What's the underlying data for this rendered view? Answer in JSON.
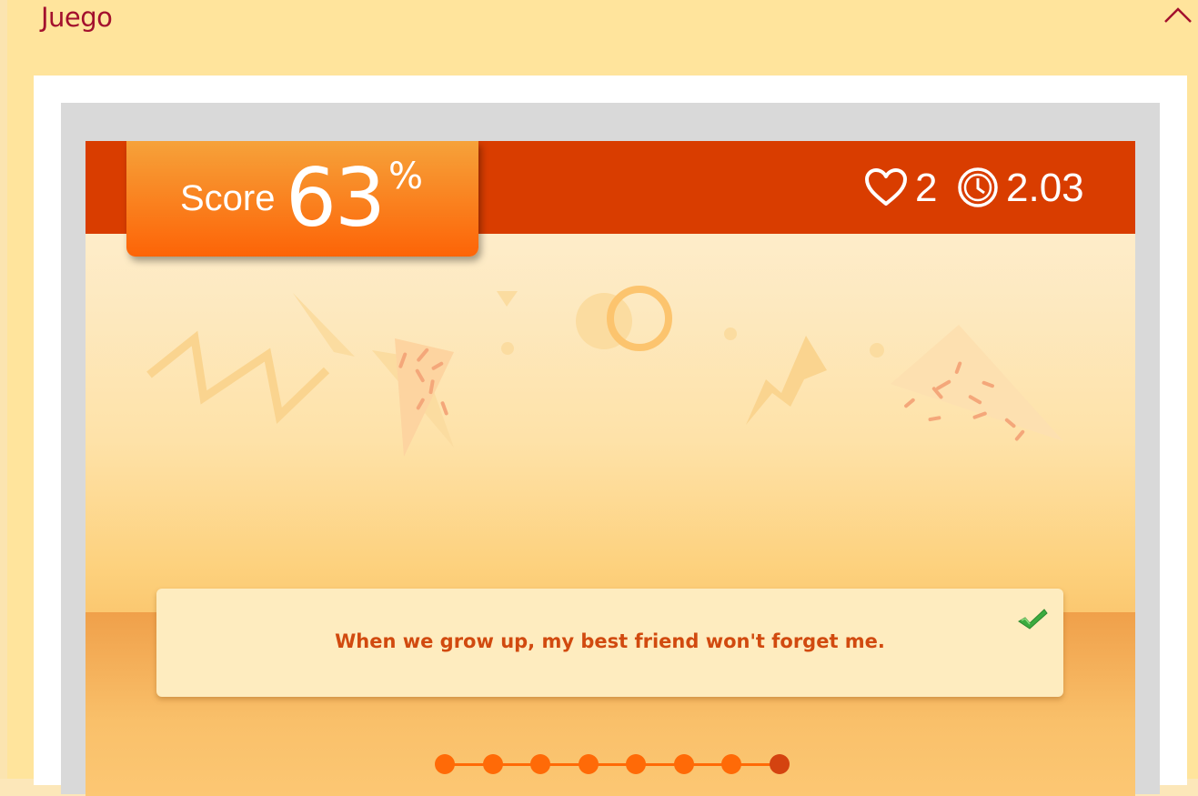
{
  "section": {
    "title": "Juego",
    "collapse_icon": "chevron-up-icon"
  },
  "game": {
    "score": {
      "label": "Score",
      "value": "63",
      "unit": "%"
    },
    "hud": {
      "lives_icon": "heart-icon",
      "lives": "2",
      "time_icon": "clock-icon",
      "time": "2.03"
    },
    "answer": {
      "text": "When we grow up, my best friend won't forget me.",
      "status_icon": "check-icon",
      "status": "correct"
    },
    "progress": {
      "total_steps": 8,
      "current_step": 8
    }
  },
  "colors": {
    "title": "#a3102d",
    "topbar": "#d93d00",
    "score_badge": "#fd6407",
    "answer_text": "#d14a0f",
    "progress_dot": "#ff6a07",
    "progress_current": "#d44310",
    "panel_bg": "#ffe49c"
  }
}
